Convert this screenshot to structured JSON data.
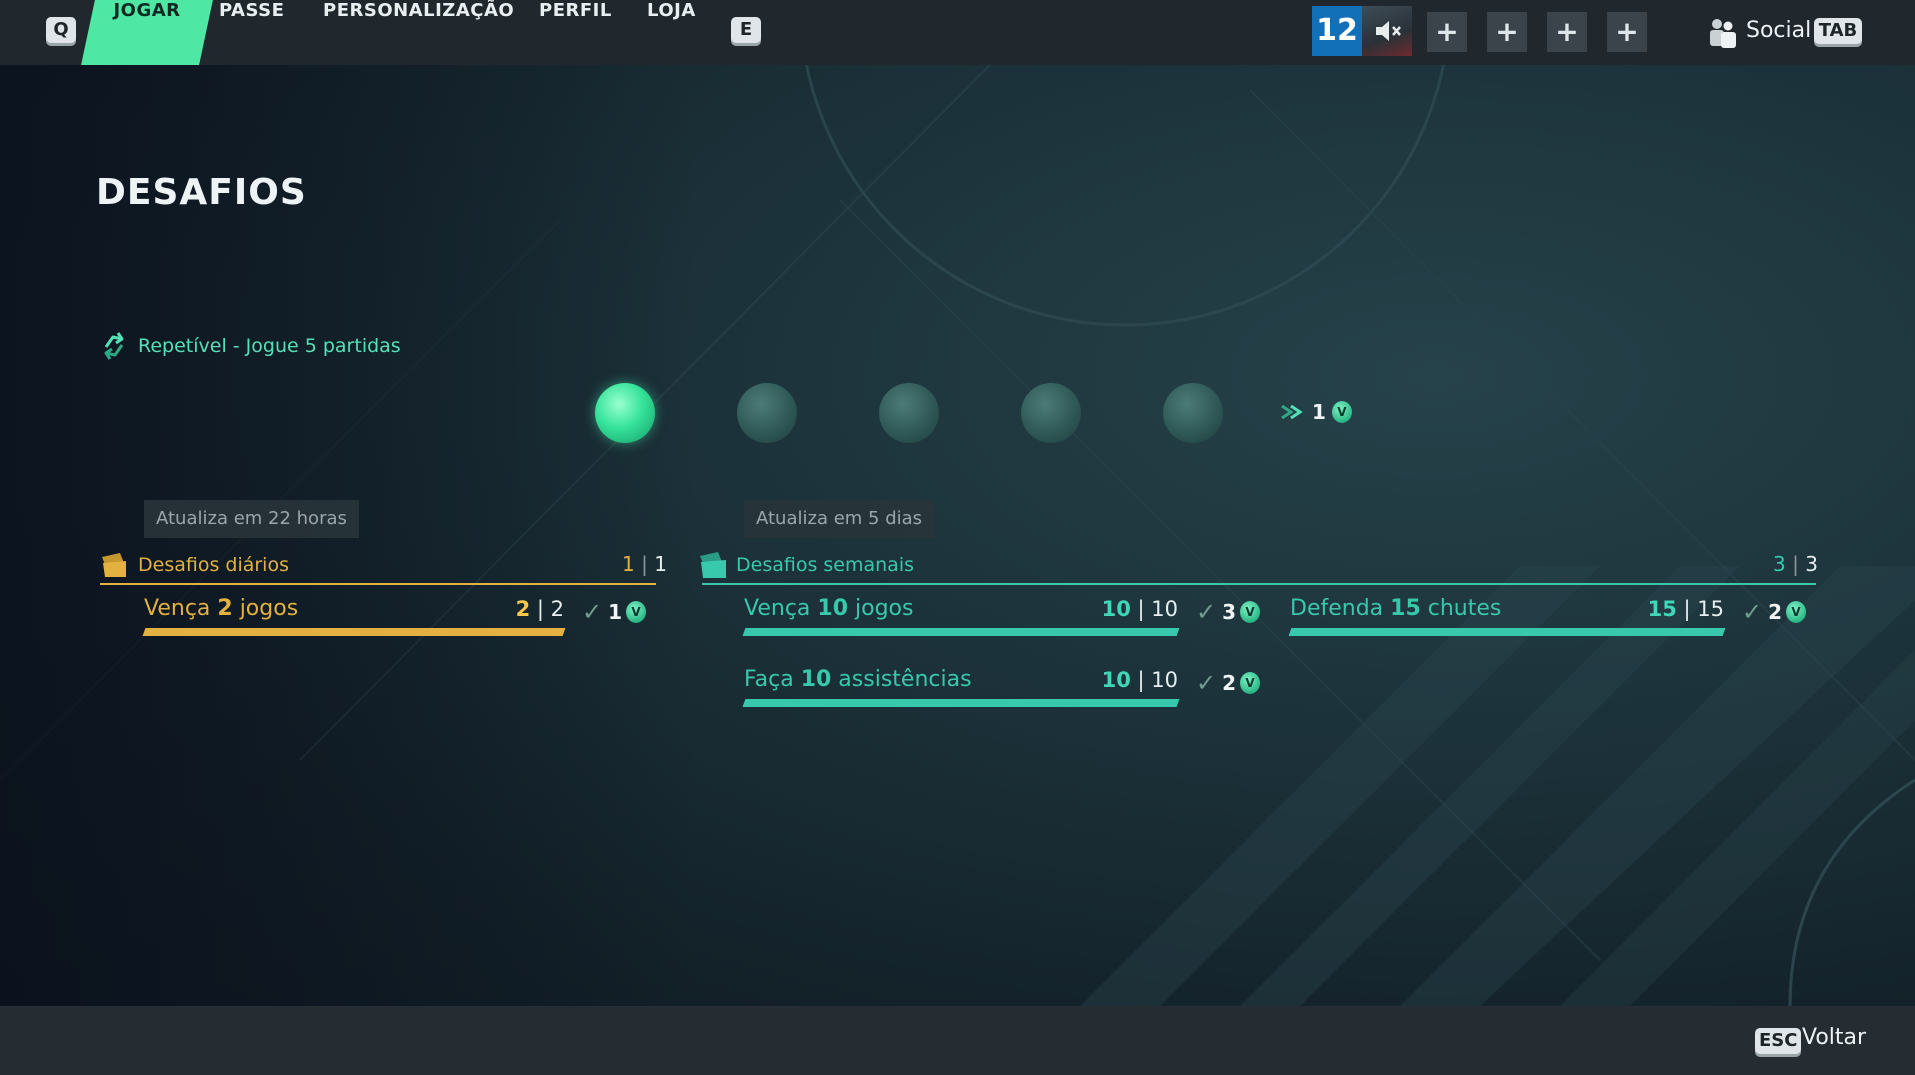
{
  "colors": {
    "accent_green": "#4ee8a4",
    "daily_gold": "#e3b13f",
    "weekly_teal": "#38c9ad",
    "level_blue": "#1170b8"
  },
  "topbar": {
    "key_left": "Q",
    "key_right": "E",
    "tabs": [
      {
        "label": "JOGAR",
        "active": true
      },
      {
        "label": "PASSE",
        "active": false
      },
      {
        "label": "PERSONALIZAÇÃO",
        "active": false
      },
      {
        "label": "PERFIL",
        "active": false
      },
      {
        "label": "LOJA",
        "active": false
      }
    ],
    "level": "12",
    "avatar_icon": "muted-speaker-icon",
    "party_slot_symbol": "+",
    "social_label": "Social",
    "social_key": "TAB"
  },
  "page": {
    "title": "DESAFIOS"
  },
  "repeatable": {
    "icon": "repeat-arrows-icon",
    "label": "Repetível - Jogue 5 partidas",
    "total_matches": 5,
    "completed_matches": 1,
    "reward_count": "1"
  },
  "daily": {
    "refresh": "Atualiza em 22 horas",
    "title": "Desafios diários",
    "done": "1",
    "total": "1",
    "challenges": [
      {
        "prefix": "Vença ",
        "num": "2",
        "suffix": " jogos",
        "current": "2",
        "target": "2",
        "fraction": 1.0,
        "reward": "1"
      }
    ]
  },
  "weekly": {
    "refresh": "Atualiza em 5 dias",
    "title": "Desafios semanais",
    "done": "3",
    "total": "3",
    "challenges": [
      {
        "prefix": "Vença ",
        "num": "10",
        "suffix": " jogos",
        "current": "10",
        "target": "10",
        "fraction": 1.0,
        "reward": "3"
      },
      {
        "prefix": "Defenda ",
        "num": "15",
        "suffix": " chutes",
        "current": "15",
        "target": "15",
        "fraction": 1.0,
        "reward": "2"
      },
      {
        "prefix": "Faça ",
        "num": "10",
        "suffix": " assistências",
        "current": "10",
        "target": "10",
        "fraction": 1.0,
        "reward": "2"
      }
    ]
  },
  "footer": {
    "key": "ESC",
    "back_label": "Voltar"
  }
}
